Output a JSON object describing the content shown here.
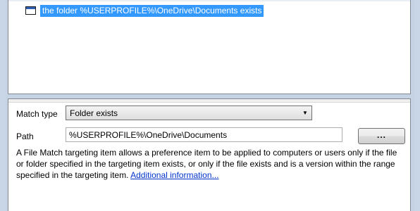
{
  "tree": {
    "items": [
      {
        "label": "the folder %USERPROFILE%\\OneDrive\\Documents exists",
        "icon": "targeting-item-icon",
        "selected": true
      }
    ]
  },
  "properties": {
    "match_type_label": "Match type",
    "match_type_value": "Folder exists",
    "path_label": "Path",
    "path_value": "%USERPROFILE%\\OneDrive\\Documents",
    "browse_label": "...",
    "description": "A File Match targeting item allows a preference item to be applied to computers or users only if the file or folder specified in the targeting item exists, or only if the file exists and is a version within the range specified in the targeting item.",
    "link_text": "Additional information..."
  },
  "colors": {
    "selection": "#3399ff",
    "link": "#0033cc",
    "frame": "#c5d3e4"
  }
}
